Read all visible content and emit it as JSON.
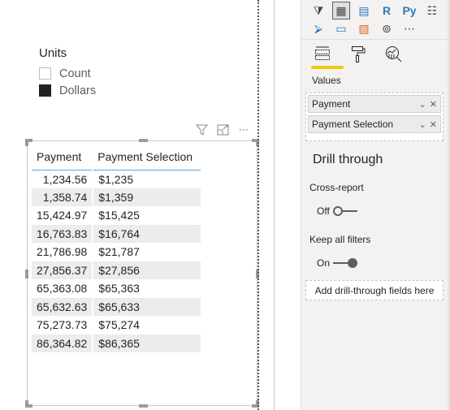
{
  "slicer": {
    "title": "Units",
    "items": [
      {
        "label": "Count",
        "checked": false
      },
      {
        "label": "Dollars",
        "checked": true
      }
    ]
  },
  "visual_header": {
    "icons": [
      "filter-icon",
      "focus-mode-icon",
      "more-options-icon"
    ],
    "more_label": "⋯"
  },
  "table": {
    "columns": [
      "Payment",
      "Payment Selection"
    ],
    "rows": [
      [
        "1,234.56",
        "$1,235"
      ],
      [
        "1,358.74",
        "$1,359"
      ],
      [
        "15,424.97",
        "$15,425"
      ],
      [
        "16,763.83",
        "$16,764"
      ],
      [
        "21,786.98",
        "$21,787"
      ],
      [
        "27,856.37",
        "$27,856"
      ],
      [
        "65,363.08",
        "$65,363"
      ],
      [
        "65,632.63",
        "$65,633"
      ],
      [
        "75,273.73",
        "$75,274"
      ],
      [
        "86,364.82",
        "$86,365"
      ]
    ]
  },
  "pane": {
    "visuals": [
      {
        "name": "slicer-visual-icon",
        "glyph": "⧩"
      },
      {
        "name": "table-visual-icon",
        "glyph": "▦",
        "selected": true
      },
      {
        "name": "matrix-visual-icon",
        "glyph": "▤"
      },
      {
        "name": "r-visual-icon",
        "glyph": "R"
      },
      {
        "name": "python-visual-icon",
        "glyph": "Py"
      },
      {
        "name": "key-influencers-icon",
        "glyph": "☷"
      },
      {
        "name": "decomposition-tree-icon",
        "glyph": "⮚"
      },
      {
        "name": "qa-visual-icon",
        "glyph": "▭"
      },
      {
        "name": "arcgis-map-icon",
        "glyph": "▧"
      },
      {
        "name": "power-apps-icon",
        "glyph": "⊚"
      },
      {
        "name": "more-visuals-icon",
        "glyph": "⋯"
      }
    ],
    "tabs": [
      {
        "name": "fields-tab",
        "active": true
      },
      {
        "name": "format-tab",
        "active": false
      },
      {
        "name": "analytics-tab",
        "active": false
      }
    ],
    "values_label": "Values",
    "fields": [
      "Payment",
      "Payment Selection"
    ],
    "drill_through": {
      "title": "Drill through",
      "cross_report_label": "Cross-report",
      "cross_report_state": "Off",
      "keep_filters_label": "Keep all filters",
      "keep_filters_state": "On",
      "drop_zone_label": "Add drill-through fields here"
    },
    "accent_color": "#f2c811"
  }
}
